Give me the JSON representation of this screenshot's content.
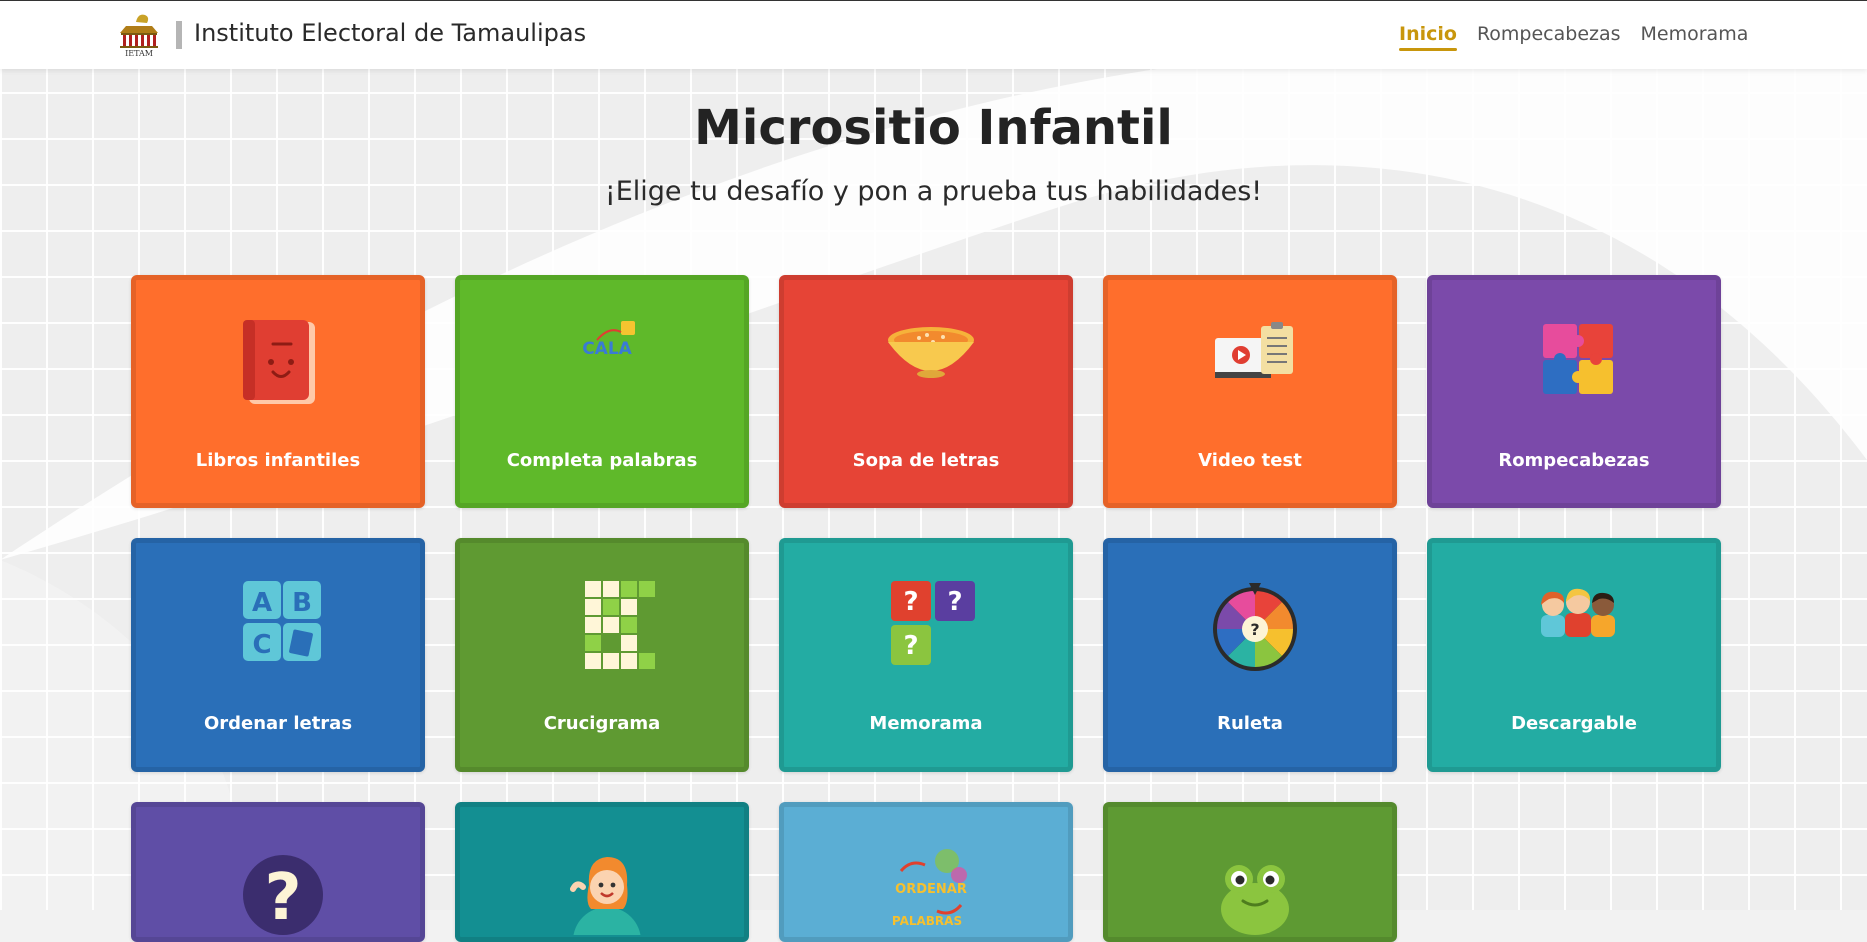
{
  "header": {
    "logo_text": "IETAM",
    "brand": "Instituto Electoral de Tamaulipas",
    "nav": [
      {
        "label": "Inicio",
        "active": true
      },
      {
        "label": "Rompecabezas",
        "active": false
      },
      {
        "label": "Memorama",
        "active": false
      }
    ]
  },
  "hero": {
    "title": "Micrositio Infantil",
    "subtitle": "¡Elige tu desafío y pon a prueba tus habilidades!"
  },
  "cards": [
    {
      "label": "Libros infantiles",
      "color": "#ff6e2c",
      "icon": "book-icon"
    },
    {
      "label": "Completa palabras",
      "color": "#5fb92a",
      "icon": "letter-blocks-icon"
    },
    {
      "label": "Sopa de letras",
      "color": "#e64436",
      "icon": "soup-bowl-icon"
    },
    {
      "label": "Video test",
      "color": "#ff6e2c",
      "icon": "video-checklist-icon"
    },
    {
      "label": "Rompecabezas",
      "color": "#7b4aaa",
      "icon": "puzzle-pieces-icon"
    },
    {
      "label": "Ordenar letras",
      "color": "#2a6fb8",
      "icon": "abc-blocks-icon"
    },
    {
      "label": "Crucigrama",
      "color": "#5f9a32",
      "icon": "crossword-icon"
    },
    {
      "label": "Memorama",
      "color": "#23aca3",
      "icon": "memory-cards-icon"
    },
    {
      "label": "Ruleta",
      "color": "#2a6fb8",
      "icon": "prize-wheel-icon"
    },
    {
      "label": "Descargable",
      "color": "#23aca3",
      "icon": "children-group-icon"
    },
    {
      "label": "",
      "color": "#5f4ea6",
      "icon": "question-mark-icon"
    },
    {
      "label": "",
      "color": "#138f92",
      "icon": "girl-globe-icon"
    },
    {
      "label": "",
      "color": "#5baed4",
      "icon": "ordenar-palabras-icon"
    },
    {
      "label": "",
      "color": "#5e9a33",
      "icon": "frog-icon"
    }
  ],
  "icon_texts": {
    "abc": [
      "A",
      "B",
      "C"
    ],
    "question": "?",
    "completa": "CALA",
    "ordenar": "ORDENAR",
    "palabras": "PALABRAS"
  }
}
